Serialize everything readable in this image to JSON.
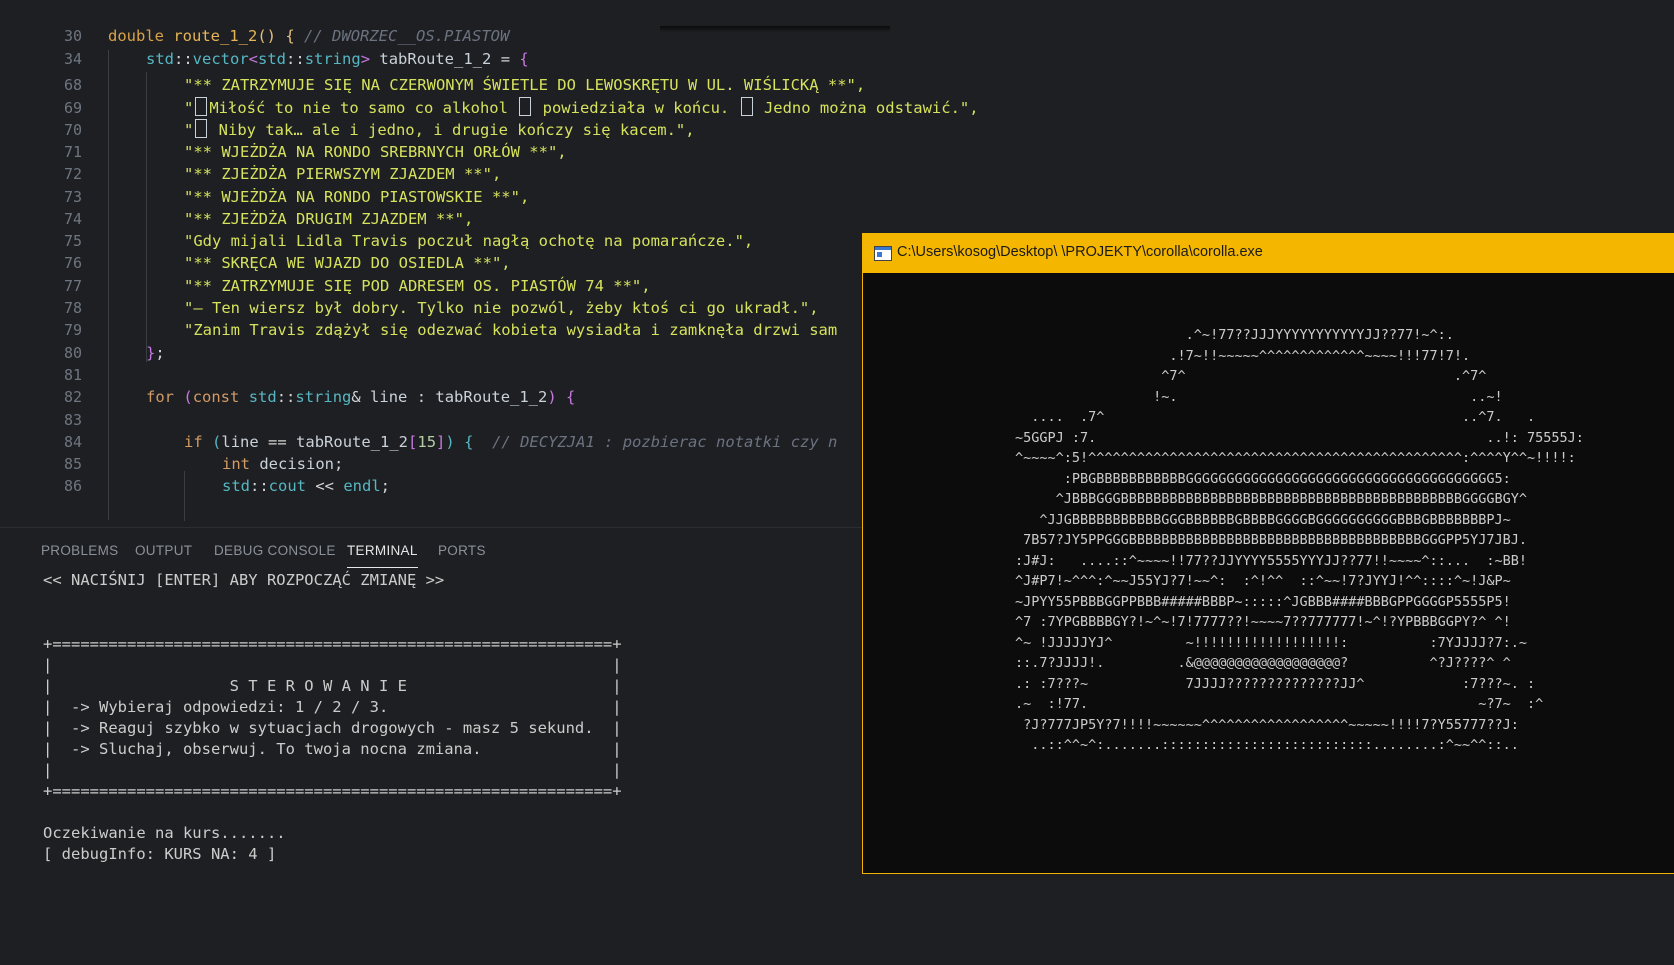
{
  "editor": {
    "lines": [
      {
        "n": "30",
        "segs": [
          [
            "kw2",
            "double "
          ],
          [
            "fn",
            "route_1_2"
          ],
          [
            "br",
            "()"
          ],
          [
            "pu",
            " "
          ],
          [
            "br",
            "{"
          ],
          [
            "pu",
            " "
          ],
          [
            "cm",
            "// DWORZEC__OS.PIASTOW"
          ]
        ]
      },
      {
        "n": "34",
        "segs": [
          [
            "ty",
            "std"
          ],
          [
            "pu",
            "::"
          ],
          [
            "ty",
            "vector"
          ],
          [
            "br2",
            "<"
          ],
          [
            "ty",
            "std"
          ],
          [
            "pu",
            "::"
          ],
          [
            "ty",
            "string"
          ],
          [
            "br2",
            ">"
          ],
          [
            "id",
            " tabRoute_1_2 "
          ],
          [
            "pu",
            "= "
          ],
          [
            "br2",
            "{"
          ]
        ]
      },
      {
        "n": "68",
        "segs": [
          [
            "st",
            "\"** ZATRZYMUJE SIĘ NA CZERWONYM ŚWIETLE DO LEWOSKRĘTU W UL. WIŚLICKĄ **\","
          ]
        ]
      },
      {
        "n": "69",
        "segs": [
          [
            "st",
            "\""
          ],
          [
            "box",
            ""
          ],
          [
            "st",
            "Miłość to nie to samo co alkohol "
          ],
          [
            "box",
            ""
          ],
          [
            "st",
            " powiedziała w końcu. "
          ],
          [
            "box",
            ""
          ],
          [
            "st",
            " Jedno można odstawić.\","
          ]
        ]
      },
      {
        "n": "70",
        "segs": [
          [
            "st",
            "\""
          ],
          [
            "box",
            ""
          ],
          [
            "st",
            " Niby tak… ale i jedno, i drugie kończy się kacem.\","
          ]
        ]
      },
      {
        "n": "71",
        "segs": [
          [
            "st",
            "\"** WJEŻDŻA NA RONDO SREBRNYCH ORŁÓW **\","
          ]
        ]
      },
      {
        "n": "72",
        "segs": [
          [
            "st",
            "\"** ZJEŻDŻA PIERWSZYM ZJAZDEM **\","
          ]
        ]
      },
      {
        "n": "73",
        "segs": [
          [
            "st",
            "\"** WJEŻDŻA NA RONDO PIASTOWSKIE **\","
          ]
        ]
      },
      {
        "n": "74",
        "segs": [
          [
            "st",
            "\"** ZJEŻDŻA DRUGIM ZJAZDEM **\","
          ]
        ]
      },
      {
        "n": "75",
        "segs": [
          [
            "st",
            "\"Gdy mijali Lidla Travis poczuł nagłą ochotę na pomarańcze.\","
          ]
        ]
      },
      {
        "n": "76",
        "segs": [
          [
            "st",
            "\"** SKRĘCA WE WJAZD DO OSIEDLA **\","
          ]
        ]
      },
      {
        "n": "77",
        "segs": [
          [
            "st",
            "\"** ZATRZYMUJE SIĘ POD ADRESEM OS. PIASTÓW 74 **\","
          ]
        ]
      },
      {
        "n": "78",
        "segs": [
          [
            "st",
            "\"– Ten wiersz był dobry. Tylko nie pozwól, żeby ktoś ci go ukradł.\","
          ]
        ]
      },
      {
        "n": "79",
        "segs": [
          [
            "st",
            "\"Zanim Travis zdążył się odezwać kobieta wysiadła i zamknęła drzwi sam"
          ]
        ]
      },
      {
        "n": "80",
        "segs": [
          [
            "br2",
            "}"
          ],
          [
            "pu",
            ";"
          ]
        ]
      },
      {
        "n": "81",
        "segs": []
      },
      {
        "n": "82",
        "segs": [
          [
            "kw",
            "for"
          ],
          [
            "pu",
            " "
          ],
          [
            "br2",
            "("
          ],
          [
            "kw",
            "const"
          ],
          [
            "pu",
            " "
          ],
          [
            "ty",
            "std"
          ],
          [
            "pu",
            "::"
          ],
          [
            "ty",
            "string"
          ],
          [
            "pu",
            "& "
          ],
          [
            "id",
            "line : tabRoute_1_2"
          ],
          [
            "br2",
            ")"
          ],
          [
            "pu",
            " "
          ],
          [
            "br2",
            "{"
          ]
        ]
      },
      {
        "n": "83",
        "segs": []
      },
      {
        "n": "84",
        "segs": [
          [
            "kw",
            "if"
          ],
          [
            "pu",
            " "
          ],
          [
            "ty",
            "("
          ],
          [
            "id",
            "line "
          ],
          [
            "pu",
            "== "
          ],
          [
            "id",
            "tabRoute_1_2"
          ],
          [
            "br2",
            "["
          ],
          [
            "num",
            "15"
          ],
          [
            "br2",
            "]"
          ],
          [
            "ty",
            ")"
          ],
          [
            "pu",
            " "
          ],
          [
            "ty",
            "{"
          ],
          [
            "pu",
            "  "
          ],
          [
            "cm",
            "// DECYZJA1 : pozbierac notatki czy n"
          ]
        ]
      },
      {
        "n": "85",
        "segs": [
          [
            "kw",
            "int"
          ],
          [
            "id",
            " decision"
          ],
          [
            "pu",
            ";"
          ]
        ]
      },
      {
        "n": "86",
        "segs": [
          [
            "ty",
            "std"
          ],
          [
            "pu",
            "::"
          ],
          [
            "ty",
            "cout"
          ],
          [
            "pu",
            " << "
          ],
          [
            "ty",
            "endl"
          ],
          [
            "pu",
            ";"
          ]
        ]
      }
    ]
  },
  "panel": {
    "tabs": [
      "PROBLEMS",
      "OUTPUT",
      "DEBUG CONSOLE",
      "TERMINAL",
      "PORTS"
    ],
    "active_tab": "TERMINAL",
    "terminal_lines": [
      "<< NACIŚNIJ [ENTER] ABY ROZPOCZĄĆ ZMIANĘ >>",
      "",
      "",
      "+============================================================+",
      "|                                                            |",
      "|                   S T E R O W A N I E                      |",
      "|  -> Wybieraj odpowiedzi: 1 / 2 / 3.                        |",
      "|  -> Reaguj szybko w sytuacjach drogowych - masz 5 sekund.  |",
      "|  -> Sluchaj, obserwuj. To twoja nocna zmiana.              |",
      "|                                                            |",
      "+============================================================+",
      "",
      "Oczekiwanie na kurs.......",
      "[ debugInfo: KURS NA: 4 ]"
    ]
  },
  "console": {
    "title": "C:\\Users\\kosog\\Desktop\\ \\PROJEKTY\\corolla\\corolla.exe",
    "ascii_lines": [
      "                     .^~!77??JJJYYYYYYYYYYYJJ??77!~^:.",
      "                   .!7~!!~~~~~^^^^^^^^^^^^^~~~~!!!77!7!.",
      "                  ^7^                                 .^7^",
      "                 !~.                                    ..~!",
      "  ....  .7^                                            ..^7.   .",
      "~5GGPJ :7.                                                ..!: 75555J:",
      "^~~~~^:5!^^^^^^^^^^^^^^^^^^^^^^^^^^^^^^^^^^^^^^^^^^^^^^:^^^^Y^^~!!!!:",
      "      :PBGBBBBBBBBBBBGGGGGGGGGGGGGGGGGGGGGGGGGGGGGGGGGGGGGG5:",
      "     ^JBBBGGGBBBBBBBBBBBBBBBBBBBBBBBBBBBBBBBBBBBBBBBBBBGGGGBGY^",
      "   ^JJGBBBBBBBBBBBGGGBBBBBBGBBBBGGGGBGGGGGGGGGGBBBGBBBBBBBPJ~",
      " 7B57?JY5PPGGGBBBBBBBBBBBBBBBBBBBBBBBBBBBBBBBBBBBBGGGPP5YJ7JBJ.",
      ":J#J:   ....::^~~~~!!77??JJYYYY5555YYYJJ??77!!~~~~^::...  :~BB!",
      "^J#P7!~^^^:^~~J55YJ?7!~~^:  :^!^^  ::^~~!7?JYYJ!^^::::^~!J&P~",
      "~JPYY55PBBBGGPPBBB#####BBBP~:::::^JGBBB####BBBGPPGGGGP5555P5!",
      "^7 :7YPGBBBBGY?!~^~!7!7777??!~~~~7??777777!~^!?YPBBBGGPY?^ ^!",
      "^~ !JJJJJYJ^         ~!!!!!!!!!!!!!!!!!!:          :7YJJJJ?7:.~",
      "::.7?JJJJ!.         .&@@@@@@@@@@@@@@@@@@?          ^?J????^ ^",
      ".: :7???~            7JJJJ??????????????JJ^            :7???~. :",
      ".~  :!77.                                                ~?7~  :^",
      " ?J?777JP5Y?7!!!!~~~~~~^^^^^^^^^^^^^^^^^^~~~~~!!!!7?Y55777??J:",
      "  ..::^^~^:.......::::::::::::::::::::::::::........:^~~^^::.."
    ]
  }
}
